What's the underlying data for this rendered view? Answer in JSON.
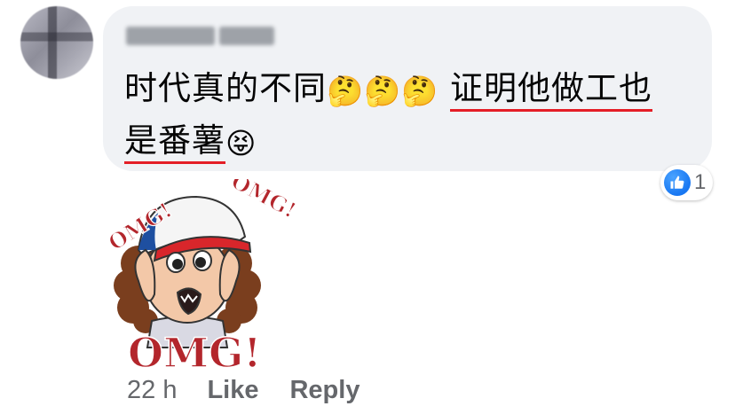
{
  "comment": {
    "author_name": "",
    "text_part1": "时代真的不同",
    "emoji_thinking": "🤔",
    "text_underlined_1": "证明他做工也",
    "text_underlined_2": "是番薯",
    "emoji_tongue": "😝",
    "reaction_count": "1",
    "sticker_text_top_left": "OMG!",
    "sticker_text_top_right": "OMG!",
    "sticker_text_bottom": "OMG!",
    "timestamp": "22 h",
    "like_label": "Like",
    "reply_label": "Reply"
  },
  "colors": {
    "bubble_bg": "#f0f2f5",
    "underline": "#e41e26",
    "like_blue": "#1877f2",
    "meta_text": "#65676b",
    "sticker_red": "#b3262c"
  },
  "icons": [
    "avatar",
    "like-icon",
    "thinking-face-emoji",
    "squinting-tongue-emoji",
    "omg-sticker"
  ]
}
